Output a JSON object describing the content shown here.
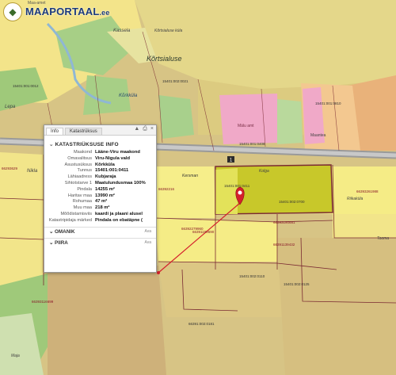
{
  "logo": {
    "text": "MAAPORTAAL",
    "suffix": ".ee",
    "tagline": "Maa-amet"
  },
  "popup": {
    "tabs": [
      "Info",
      "Katastrüksus"
    ],
    "tool_icons": [
      "like-icon",
      "print-icon",
      "close-icon"
    ],
    "close_glyph": "×",
    "section_title": "KATASTRIÜKSUSE INFO",
    "rows": [
      {
        "k": "Maakond",
        "v": "Lääne-Viru maakond"
      },
      {
        "k": "Omavalitsus",
        "v": "Viru-Nigula vald"
      },
      {
        "k": "Asustusüksus",
        "v": "Kõrkküla"
      },
      {
        "k": "Tunnus",
        "v": "15401:001:0411"
      },
      {
        "k": "Lähiaadress",
        "v": "Kubjaraja"
      },
      {
        "k": "Sihtotstarve 1",
        "v": "Maatulundusmaa 100%"
      },
      {
        "k": "Pindala",
        "v": "14255 m²"
      },
      {
        "k": "Haritav maa",
        "v": "13990 m²"
      },
      {
        "k": "Rohumaa",
        "v": "47 m²"
      },
      {
        "k": "Muu maa",
        "v": "218 m²"
      },
      {
        "k": "Mõõdistamisviis",
        "v": "kaardi ja plaani alusel"
      },
      {
        "k": "Katastripidaja märked",
        "v": "Pindala on ebatäpne ("
      }
    ],
    "folds": [
      {
        "label": "OMANIK",
        "more": "Ava"
      },
      {
        "label": "PIIRA",
        "more": "Ava"
      }
    ]
  },
  "map": {
    "place_labels": [
      "Kõrtsialuse",
      "Kõrtsialuse küla",
      "Kassela",
      "Mälu amt",
      "Maantea",
      "Kolga",
      "Kersman",
      "Lepa",
      "Nikla",
      "Tooma",
      "Maja",
      "Riikaküla",
      "Kõrkküla"
    ],
    "parcel_ids": [
      "15401:001:0411",
      "15401:001:0810",
      "15401:002:0700",
      "66393261988",
      "66392279960",
      "66391199690",
      "66391139432",
      "66393190681",
      "66393116699",
      "66293629",
      "66392216",
      "15401:002:0021",
      "15401:001:0408",
      "15401:002:0125",
      "15401:002:0110",
      "66391:002:0181",
      "15401:001:0012"
    ],
    "road_number": "1",
    "colors": {
      "agri": "#f5ec86",
      "forest": "#9fc97a",
      "residential": "#f0a9c8",
      "selected": "#c8c82a",
      "road": "#8a8a8a",
      "boundary": "#7a2a32",
      "marker": "#d4202c"
    }
  }
}
